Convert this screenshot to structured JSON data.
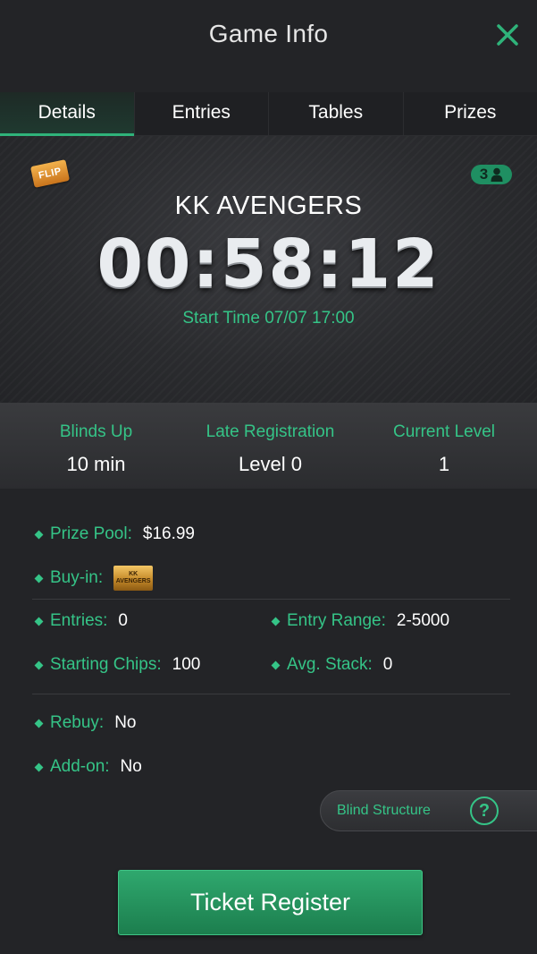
{
  "header": {
    "title": "Game Info"
  },
  "tabs": [
    {
      "label": "Details",
      "active": true
    },
    {
      "label": "Entries",
      "active": false
    },
    {
      "label": "Tables",
      "active": false
    },
    {
      "label": "Prizes",
      "active": false
    }
  ],
  "hero": {
    "badge": "FLIP",
    "player_count": "3",
    "game_name": "KK AVENGERS",
    "countdown": "00:58:12",
    "start_time": "Start Time 07/07 17:00"
  },
  "stats": [
    {
      "label": "Blinds Up",
      "value": "10 min"
    },
    {
      "label": "Late Registration",
      "value": "Level 0"
    },
    {
      "label": "Current Level",
      "value": "1"
    }
  ],
  "details": {
    "prize_pool": {
      "label": "Prize Pool:",
      "value": "$16.99"
    },
    "buy_in": {
      "label": "Buy-in:",
      "ticket_text": "KK AVENGERS"
    },
    "entries": {
      "label": "Entries:",
      "value": "0"
    },
    "entry_range": {
      "label": "Entry Range:",
      "value": "2-5000"
    },
    "starting_chips": {
      "label": "Starting Chips:",
      "value": "100"
    },
    "avg_stack": {
      "label": "Avg. Stack:",
      "value": "0"
    },
    "rebuy": {
      "label": "Rebuy:",
      "value": "No"
    },
    "addon": {
      "label": "Add-on:",
      "value": "No"
    }
  },
  "blind_structure": {
    "label": "Blind Structure",
    "help": "?"
  },
  "register_button": {
    "label": "Ticket Register"
  },
  "colors": {
    "accent": "#35c487",
    "background": "#232427",
    "button": "#2fa86e"
  },
  "icons": {
    "close": "close-icon",
    "player": "person-icon",
    "help": "help-icon"
  }
}
